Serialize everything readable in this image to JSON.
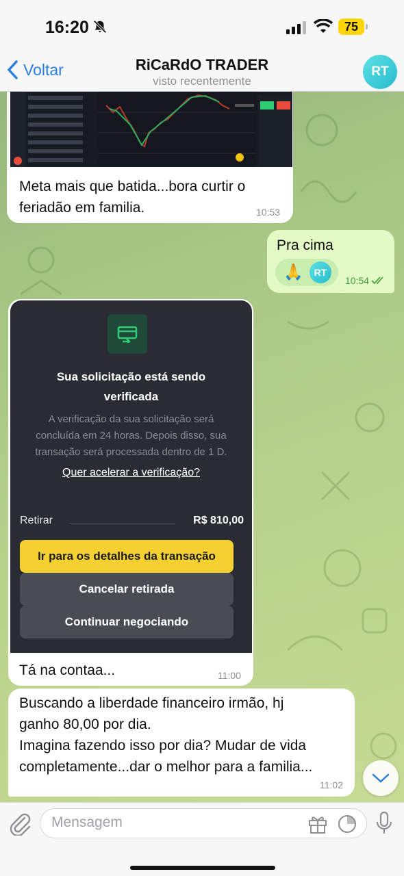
{
  "status_bar": {
    "time": "16:20",
    "battery": "75"
  },
  "header": {
    "back_label": "Voltar",
    "title": "RiCaRdO TRADER",
    "subtitle": "visto recentemente",
    "avatar_initials": "RT"
  },
  "messages": [
    {
      "type": "in",
      "text_lines": [
        "Meta mais que batida...bora curtir o",
        "feriadão em familia."
      ],
      "time": "10:53"
    },
    {
      "type": "out",
      "text": "Pra cima",
      "reaction_emoji": "🙏",
      "reaction_avatar": "RT",
      "time": "10:54"
    },
    {
      "type": "in",
      "caption": "Tá na contaa...",
      "time": "11:00"
    },
    {
      "type": "in",
      "text_lines": [
        "Buscando a liberdade financeiro irmão, hj",
        "ganho 80,00 por dia.",
        "Imagina fazendo isso por dia? Mudar de vida",
        "completamente...dar o melhor para a familia..."
      ],
      "time": "11:02"
    }
  ],
  "modal": {
    "title_lines": [
      "Sua solicitação está sendo",
      "verificada"
    ],
    "desc_lines": [
      "A verificação da sua solicitação será",
      "concluída em 24 horas. Depois disso, sua",
      "transação será processada dentro de 1 D."
    ],
    "link": "Quer acelerar a verificação?",
    "row_label": "Retirar",
    "row_value": "R$ 810,00",
    "buttons": [
      "Ir para os detalhes da transação",
      "Cancelar retirada",
      "Continuar negociando"
    ]
  },
  "composer": {
    "placeholder": "Mensagem"
  },
  "colors": {
    "accent": "#2b7de0",
    "out_bubble": "#e3f9c6",
    "modal_bg": "#2a2c33",
    "modal_primary": "#f5d031"
  }
}
